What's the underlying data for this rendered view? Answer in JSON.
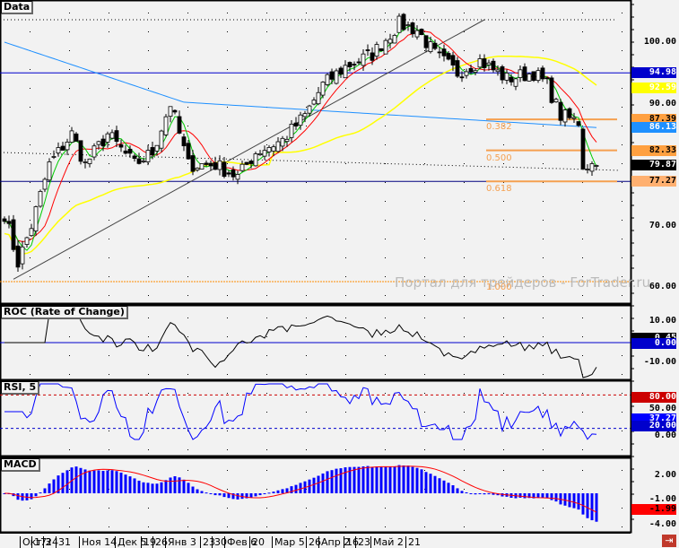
{
  "panels": {
    "main": "Data",
    "roc": "ROC (Rate of Change)",
    "rsi": "RSI, 5",
    "macd": "MACD"
  },
  "axis": {
    "main": [
      "100.00",
      "90.00",
      "70.00",
      "60.00"
    ],
    "roc": [
      "10.00",
      "-10.00"
    ],
    "rsi": [
      "50.00",
      "0.00"
    ],
    "macd": [
      "2.00",
      "-1.00",
      "-4.00"
    ]
  },
  "badges": {
    "main": [
      {
        "v": "94.98",
        "bg": "#0000cc",
        "fg": "#fff",
        "p": 94.98
      },
      {
        "v": "92.59",
        "bg": "#ffff00",
        "fg": "#fff",
        "p": 92.59
      },
      {
        "v": "87.39",
        "bg": "#ffa040",
        "fg": "#000",
        "p": 87.39
      },
      {
        "v": "86.13",
        "bg": "#1e90ff",
        "fg": "#fff",
        "p": 86.13
      },
      {
        "v": "82.33",
        "bg": "#ffa040",
        "fg": "#000",
        "p": 82.33
      },
      {
        "v": "79.87",
        "bg": "#000",
        "fg": "#fff",
        "p": 79.87
      },
      {
        "v": "77.27",
        "bg": "#ffb070",
        "fg": "#000",
        "p": 77.27
      }
    ],
    "roc": [
      {
        "v": "0.45",
        "bg": "#000",
        "fg": "#fff"
      },
      {
        "v": "0.00",
        "bg": "#0000cc",
        "fg": "#fff"
      }
    ],
    "rsi": [
      {
        "v": "80.00",
        "bg": "#cc0000",
        "fg": "#fff"
      },
      {
        "v": "37.27",
        "bg": "#0000ff",
        "fg": "#fff"
      },
      {
        "v": "20.00",
        "bg": "#0000cc",
        "fg": "#fff"
      }
    ],
    "macd": [
      {
        "v": "-1.99",
        "bg": "#ff0000",
        "fg": "#000"
      }
    ]
  },
  "fib": [
    {
      "label": "0.382",
      "p": 87.39
    },
    {
      "label": "0.500",
      "p": 82.33
    },
    {
      "label": "0.618",
      "p": 77.27
    },
    {
      "label": "1.000",
      "p": 61.2
    }
  ],
  "xlabels": [
    "Окт 3",
    "17",
    "24",
    "31",
    "Ноя 14",
    "Дек 5",
    "19",
    "26",
    "Янв 3",
    "23",
    "30",
    "Фев 6",
    "20",
    "Мар 5",
    "26",
    "Апр 2",
    "16",
    "23",
    "Май 2",
    "21"
  ],
  "watermark": "Портал для трейдеров - ForTrader.ru",
  "exit_icon": "exit-icon",
  "chart_data": {
    "type": "candlestick",
    "bars": 133,
    "close_keypoints": [
      [
        0,
        72
      ],
      [
        3,
        64
      ],
      [
        6,
        70
      ],
      [
        10,
        80
      ],
      [
        15,
        85
      ],
      [
        18,
        80
      ],
      [
        23,
        85
      ],
      [
        29,
        80
      ],
      [
        33,
        82
      ],
      [
        37,
        90
      ],
      [
        41,
        80
      ],
      [
        47,
        80
      ],
      [
        52,
        78
      ],
      [
        56,
        82
      ],
      [
        62,
        84
      ],
      [
        67,
        88
      ],
      [
        71,
        93
      ],
      [
        76,
        96
      ],
      [
        82,
        98
      ],
      [
        88,
        103
      ],
      [
        92,
        102
      ],
      [
        96,
        98
      ],
      [
        101,
        95
      ],
      [
        106,
        97
      ],
      [
        112,
        94
      ],
      [
        118,
        95
      ],
      [
        121,
        93
      ],
      [
        124,
        88
      ],
      [
        128,
        87
      ],
      [
        129,
        80
      ],
      [
        131,
        80
      ],
      [
        133,
        79.87
      ]
    ],
    "hlines": [
      94.98,
      77.27
    ]
  }
}
